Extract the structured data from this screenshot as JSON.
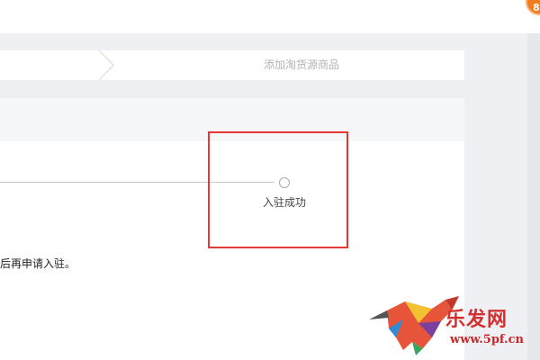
{
  "header": {
    "notification_count": "8"
  },
  "steps": {
    "current_step_label": "添加淘货源商品"
  },
  "progress": {
    "final_step_label": "入驻成功"
  },
  "notice": {
    "text": "后再申请入驻。"
  },
  "watermark": {
    "brand": "乐发网",
    "url": "www.5pf.cn"
  },
  "colors": {
    "highlight": "#e53935",
    "badge": "#f07c1d",
    "page_bg": "#eff0f3"
  }
}
